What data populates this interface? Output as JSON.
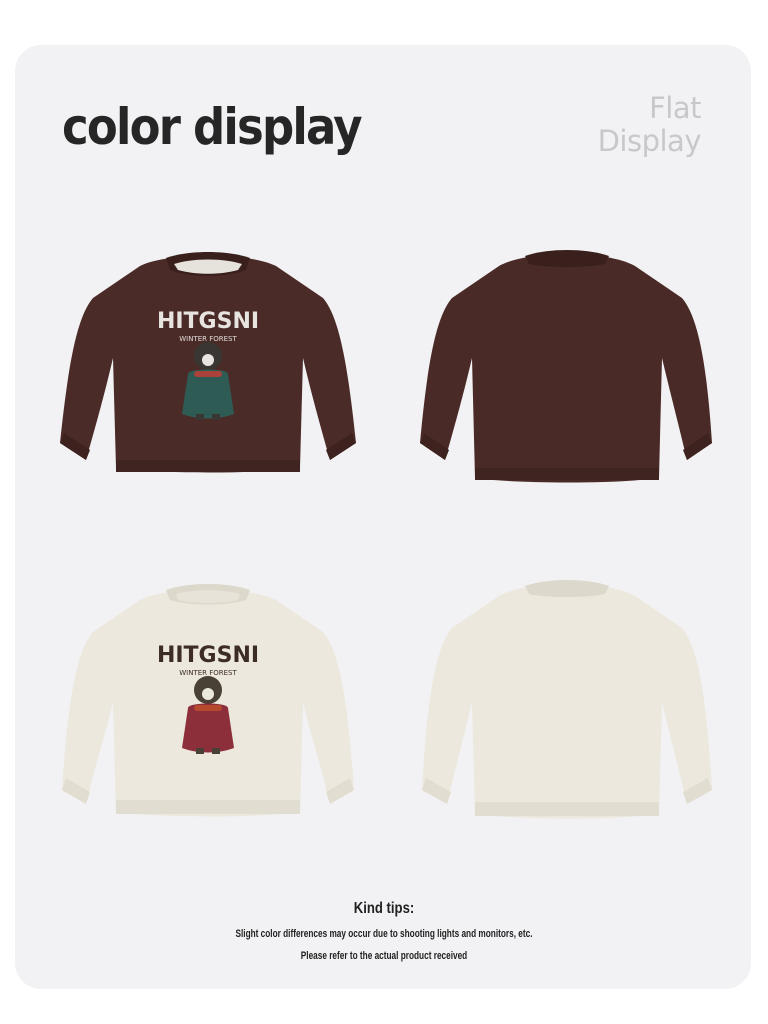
{
  "header": {
    "title": "color display",
    "flat_line1": "Flat",
    "flat_line2": "Display"
  },
  "products": [
    {
      "name": "brown-front",
      "color": "#4a2a26",
      "view": "front",
      "print_text": "HITGSNI",
      "print_sub": "WINTER FOREST",
      "bear_jacket": "#2f5b55"
    },
    {
      "name": "brown-back",
      "color": "#4a2a26",
      "view": "back"
    },
    {
      "name": "cream-front",
      "color": "#ece8dd",
      "view": "front",
      "print_text": "HITGSNI",
      "print_sub": "WINTER FOREST",
      "bear_jacket": "#8c2f3a"
    },
    {
      "name": "cream-back",
      "color": "#ece8dd",
      "view": "back"
    }
  ],
  "tips": {
    "title": "Kind tips:",
    "line1": "Slight color differences may occur due to shooting lights and monitors, etc.",
    "line2": "Please refer to the actual product received"
  }
}
